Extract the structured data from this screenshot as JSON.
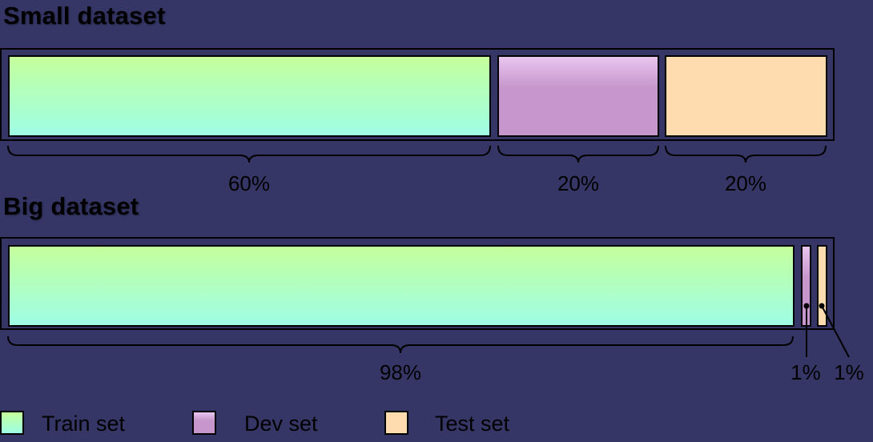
{
  "small_dataset": {
    "title": "Small dataset",
    "segments": [
      {
        "set": "train",
        "percent_label": "60%",
        "share": 60
      },
      {
        "set": "dev",
        "percent_label": "20%",
        "share": 20
      },
      {
        "set": "test",
        "percent_label": "20%",
        "share": 20
      }
    ]
  },
  "big_dataset": {
    "title": "Big dataset",
    "segments": [
      {
        "set": "train",
        "percent_label": "98%",
        "share": 98
      },
      {
        "set": "dev",
        "percent_label": "1%",
        "share": 1
      },
      {
        "set": "test",
        "percent_label": "1%",
        "share": 1
      }
    ]
  },
  "legend": [
    {
      "label": "Train set",
      "color": "#aaffdd"
    },
    {
      "label": "Dev set",
      "color": "#c696cc"
    },
    {
      "label": "Test set",
      "color": "#ffdcb0"
    }
  ],
  "colors": {
    "background": "#353666",
    "train": "#aaffdd",
    "dev": "#c696cc",
    "test": "#ffdcb0"
  }
}
